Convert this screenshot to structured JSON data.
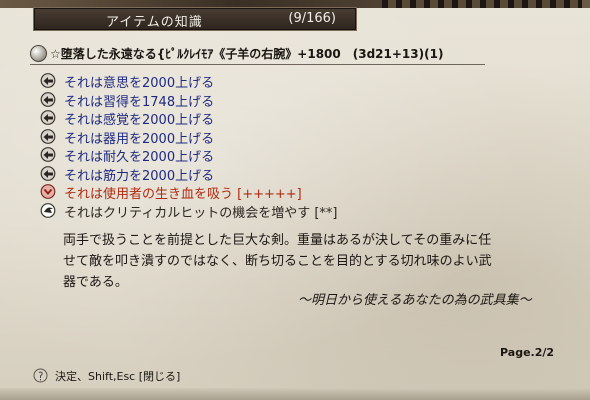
{
  "window": {
    "title": "アイテムの知識",
    "counter": "(9/166)"
  },
  "item": {
    "name": "☆堕落した永遠なる{ﾋﾟﾙｸﾚｲﾓｱ《子羊の右腕》+1800　(3d21+13)(1)"
  },
  "enchantments": [
    "それは意思を2000上げる",
    "それは習得を1748上げる",
    "それは感覚を2000上げる",
    "それは器用を2000上げる",
    "それは耐久を2000上げる",
    "それは筋力を2000上げる",
    "それは使用者の生き血を吸う [+++++]",
    "それはクリティカルヒットの機会を増やす [**]"
  ],
  "description": [
    "両手で扱うことを前提とした巨大な剣。重量はあるが決してその重みに任",
    "せて敵を叩き潰すのではなく、断ち切ることを目的とする切れ味のよい武",
    "器である。"
  ],
  "flavor": "～明日から使えるあなたの為の武具集～",
  "page": "Page.2/2",
  "footer_hint": "決定、Shift,Esc [閉じる]",
  "colors": {
    "enchant_text": "#1e2a82",
    "blood_text": "#b02a10",
    "parchment": "#e3ddd0",
    "titlebar": "#3a2f27"
  }
}
